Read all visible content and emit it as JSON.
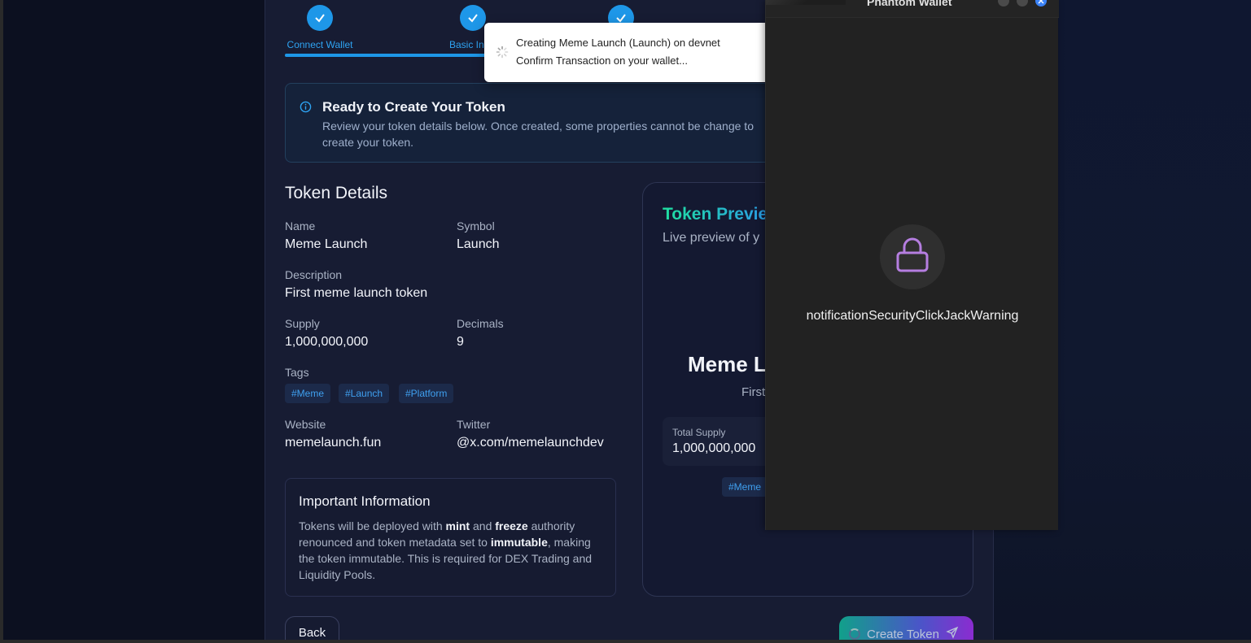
{
  "stepper": {
    "steps": [
      {
        "label": "Connect Wallet"
      },
      {
        "label": "Basic In"
      },
      {
        "label": ""
      },
      {
        "label": ""
      }
    ],
    "progress_percent": 100
  },
  "info": {
    "title": "Ready to Create Your Token",
    "text": "Review your token details below. Once created, some properties cannot be change to create your token."
  },
  "details": {
    "section_title": "Token Details",
    "name_label": "Name",
    "name_value": "Meme Launch",
    "symbol_label": "Symbol",
    "symbol_value": "Launch",
    "description_label": "Description",
    "description_value": "First meme launch token",
    "supply_label": "Supply",
    "supply_value": "1,000,000,000",
    "decimals_label": "Decimals",
    "decimals_value": "9",
    "tags_label": "Tags",
    "tags": [
      "#Meme",
      "#Launch",
      "#Platform"
    ],
    "website_label": "Website",
    "website_value": "memelaunch.fun",
    "twitter_label": "Twitter",
    "twitter_value": "@x.com/memelaunchdev"
  },
  "important": {
    "title": "Important Information",
    "t1": "Tokens will be deployed with ",
    "b1": "mint",
    "t2": " and ",
    "b2": "freeze",
    "t3": " authority renounced and token metadata set to ",
    "b3": "immutable",
    "t4": ", making the token immutable. This is required for DEX Trading and Liquidity Pools."
  },
  "preview": {
    "title": "Token Previe",
    "subtitle": "Live preview of y",
    "name": "Meme La",
    "desc": "First",
    "supply_label": "Total Supply",
    "supply_value": "1,000,000,000",
    "tag": "#Meme"
  },
  "buttons": {
    "back": "Back",
    "create": "Create Token"
  },
  "toast": {
    "line1": "Creating Meme Launch (Launch) on devnet",
    "line2": "Confirm Transaction on your wallet..."
  },
  "wallet": {
    "title": "Phantom Wallet",
    "message": "notificationSecurityClickJackWarning"
  },
  "colors": {
    "accent": "#1e97e8",
    "lock": "#b57ee0"
  }
}
